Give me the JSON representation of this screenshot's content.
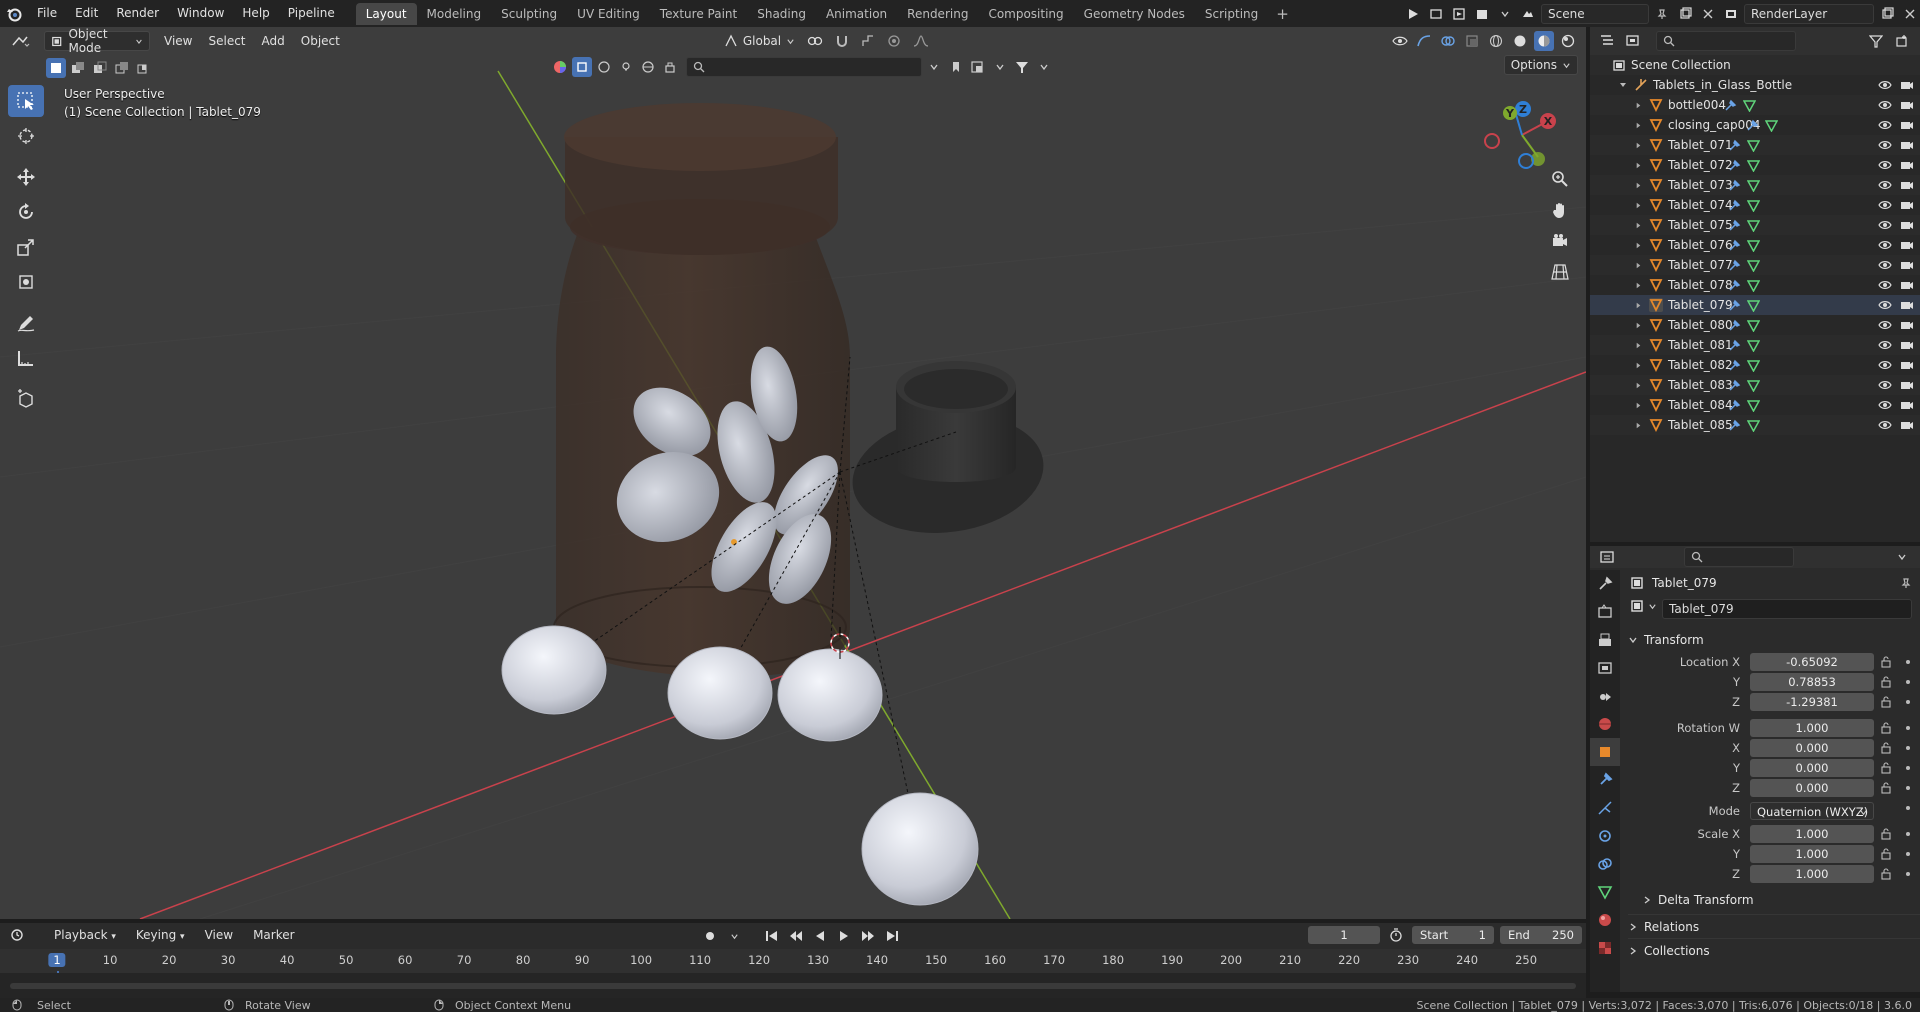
{
  "menu": {
    "items": [
      "File",
      "Edit",
      "Render",
      "Window",
      "Help",
      "Pipeline"
    ],
    "workspaces": [
      "Layout",
      "Modeling",
      "Sculpting",
      "UV Editing",
      "Texture Paint",
      "Shading",
      "Animation",
      "Rendering",
      "Compositing",
      "Geometry Nodes",
      "Scripting"
    ],
    "active_workspace": "Layout",
    "add_tab": "+"
  },
  "top_right": {
    "scene": "Scene",
    "view_layer": "RenderLayer"
  },
  "viewport": {
    "mode": "Object Mode",
    "menus": [
      "View",
      "Select",
      "Add",
      "Object"
    ],
    "orientation": "Global",
    "options_label": "Options",
    "perspective": "User Perspective",
    "context": "(1) Scene Collection | Tablet_079",
    "gizmo_axes": {
      "x": "X",
      "y": "Y",
      "z": "Z"
    },
    "colors": {
      "bg": "#3d3d3d",
      "x_axis": "#c9424c",
      "y_axis": "#7fa92d",
      "accent": "#4772b3"
    }
  },
  "outliner": {
    "root": "Scene Collection",
    "collection": "Tablets_in_Glass_Bottle",
    "items": [
      "bottle004",
      "closing_cap004",
      "Tablet_071",
      "Tablet_072",
      "Tablet_073",
      "Tablet_074",
      "Tablet_075",
      "Tablet_076",
      "Tablet_077",
      "Tablet_078",
      "Tablet_079",
      "Tablet_080",
      "Tablet_081",
      "Tablet_082",
      "Tablet_083",
      "Tablet_084",
      "Tablet_085"
    ],
    "selected": "Tablet_079"
  },
  "properties": {
    "object_name": "Tablet_079",
    "data_name": "Tablet_079",
    "transform_label": "Transform",
    "location": {
      "label_x": "Location X",
      "label_y": "Y",
      "label_z": "Z",
      "x": "-0.65092",
      "y": "0.78853",
      "z": "-1.29381"
    },
    "rotation": {
      "label_w": "Rotation W",
      "label_x": "X",
      "label_y": "Y",
      "label_z": "Z",
      "w": "1.000",
      "x": "0.000",
      "y": "0.000",
      "z": "0.000"
    },
    "mode_label": "Mode",
    "mode_value": "Quaternion (WXYZ)",
    "scale": {
      "label_x": "Scale X",
      "label_y": "Y",
      "label_z": "Z",
      "x": "1.000",
      "y": "1.000",
      "z": "1.000"
    },
    "delta_transform": "Delta Transform",
    "relations": "Relations",
    "collections": "Collections"
  },
  "timeline": {
    "menus": [
      "Playback",
      "Keying",
      "View",
      "Marker"
    ],
    "current_frame": "1",
    "start_label": "Start",
    "start": "1",
    "end_label": "End",
    "end": "250",
    "ticks": [
      "1",
      "10",
      "20",
      "30",
      "40",
      "50",
      "60",
      "70",
      "80",
      "90",
      "100",
      "110",
      "120",
      "130",
      "140",
      "150",
      "160",
      "170",
      "180",
      "190",
      "200",
      "210",
      "220",
      "230",
      "240",
      "250"
    ]
  },
  "status": {
    "select": "Select",
    "rotate": "Rotate View",
    "context_menu": "Object Context Menu",
    "stats": "Scene Collection | Tablet_079 | Verts:3,072 | Faces:3,070 | Tris:6,076 | Objects:0/18 | 3.6.0"
  }
}
